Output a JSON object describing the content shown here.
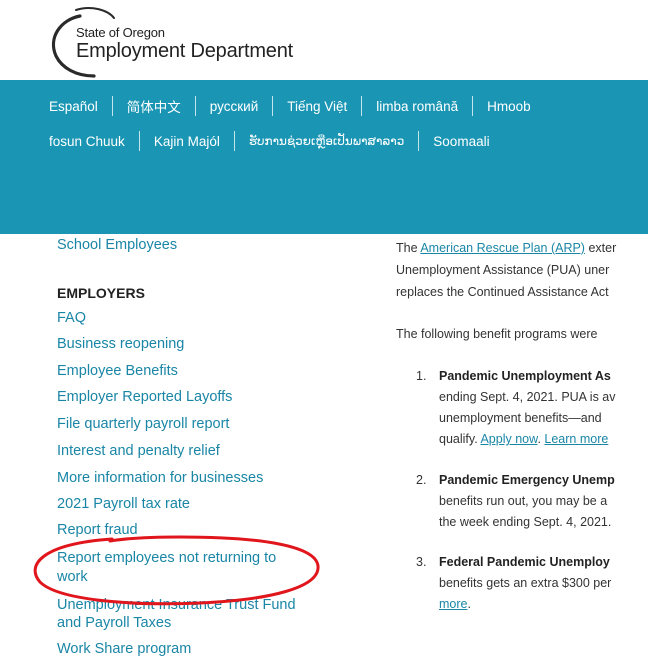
{
  "logo": {
    "small_text": "State of Oregon",
    "big_text": "Employment Department"
  },
  "languages": {
    "row1": [
      "Español",
      "简体中文",
      "русский",
      "Tiếng Việt",
      "limba română",
      "Hmoob"
    ],
    "row2": [
      "fosun Chuuk",
      "Kajin Majól",
      "ຮັບການຊ່ວຍເຫຼືອເປັນພາສາລາວ",
      "Soomaali"
    ]
  },
  "sidebar": {
    "school_employees": "School Employees",
    "employers_heading": "EMPLOYERS",
    "items": [
      "FAQ",
      "Business reopening",
      "Employee Benefits",
      "Employer Reported Layoffs",
      "File quarterly payroll report",
      "Interest and penalty relief",
      "More information for businesses",
      "2021 Payroll tax rate",
      "Report fraud",
      "Report employees not returning to",
      "work",
      "Unemployment Insurance Trust Fund",
      "and Payroll Taxes",
      "Work Share program"
    ]
  },
  "main": {
    "intro_prefix": "The ",
    "intro_link": "American Rescue Plan (ARP)",
    "intro_rest": " exter",
    "intro_line2": "Unemployment Assistance (PUA) uner",
    "intro_line3": "replaces the Continued Assistance Act",
    "programs_intro": "The following benefit programs were",
    "item1": {
      "num": "1.",
      "title": "Pandemic Unemployment As",
      "line2": "ending Sept. 4, 2021. PUA is av",
      "line3": "unemployment benefits—and",
      "line4_prefix": "qualify. ",
      "apply_link": "Apply now",
      "line4_mid": ". ",
      "learn_link": "Learn more"
    },
    "item2": {
      "num": "2.",
      "title": "Pandemic Emergency Unemp",
      "line2": "benefits run out, you may be a",
      "line3": "the week ending Sept. 4, 2021."
    },
    "item3": {
      "num": "3.",
      "title": "Federal Pandemic Unemploy",
      "line2": "benefits gets an extra $300 per",
      "more_link": "more",
      "more_suffix": "."
    }
  },
  "colors": {
    "lang_bar": "#1a96b4",
    "link": "#1a86a6",
    "annotation": "#e0161c"
  }
}
